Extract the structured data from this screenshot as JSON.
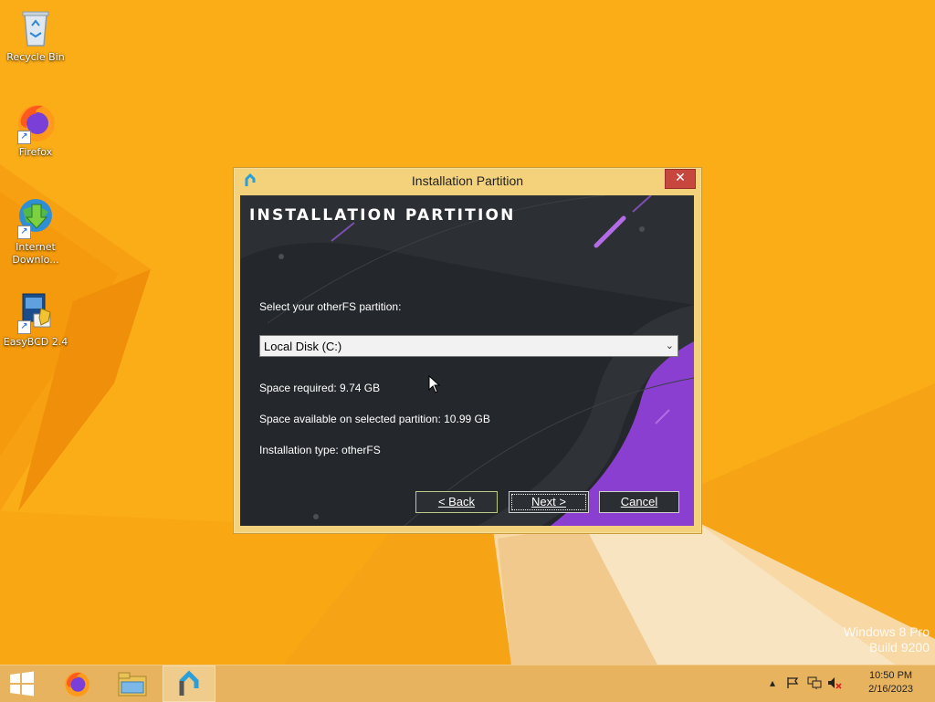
{
  "desktop": {
    "icons": [
      {
        "label": "Recycle Bin",
        "icon": "recycle-bin-icon"
      },
      {
        "label": "Firefox",
        "icon": "firefox-icon"
      },
      {
        "label": "Internet Downlo...",
        "icon": "internet-download-manager-icon"
      },
      {
        "label": "EasyBCD 2.4",
        "icon": "easybcd-icon"
      }
    ],
    "watermark": {
      "line1": "Windows 8 Pro",
      "line2": "Build 9200"
    }
  },
  "dialog": {
    "title": "Installation Partition",
    "close_glyph": "✕",
    "banner": "INSTALLATION PARTITION",
    "select_label": "Select your otherFS partition:",
    "partition_select": {
      "value": "Local Disk (C:)",
      "chevron": "⌄"
    },
    "space_required": "Space required: 9.74 GB",
    "space_available": "Space available on selected partition: 10.99 GB",
    "installation_type": "Installation type: otherFS",
    "buttons": {
      "back": "< Back",
      "next": "Next >",
      "cancel": "Cancel"
    }
  },
  "taskbar": {
    "apps": [
      "start-button",
      "firefox",
      "file-explorer",
      "installer"
    ],
    "clock": {
      "time": "10:50 PM",
      "date": "2/16/2023"
    }
  },
  "colors": {
    "wallpaper": "#f9a814",
    "dialog_frame": "#f3d27b",
    "client_bg": "#24272b",
    "accent_purple": "#8a3fd1",
    "close_red": "#c7463d"
  }
}
